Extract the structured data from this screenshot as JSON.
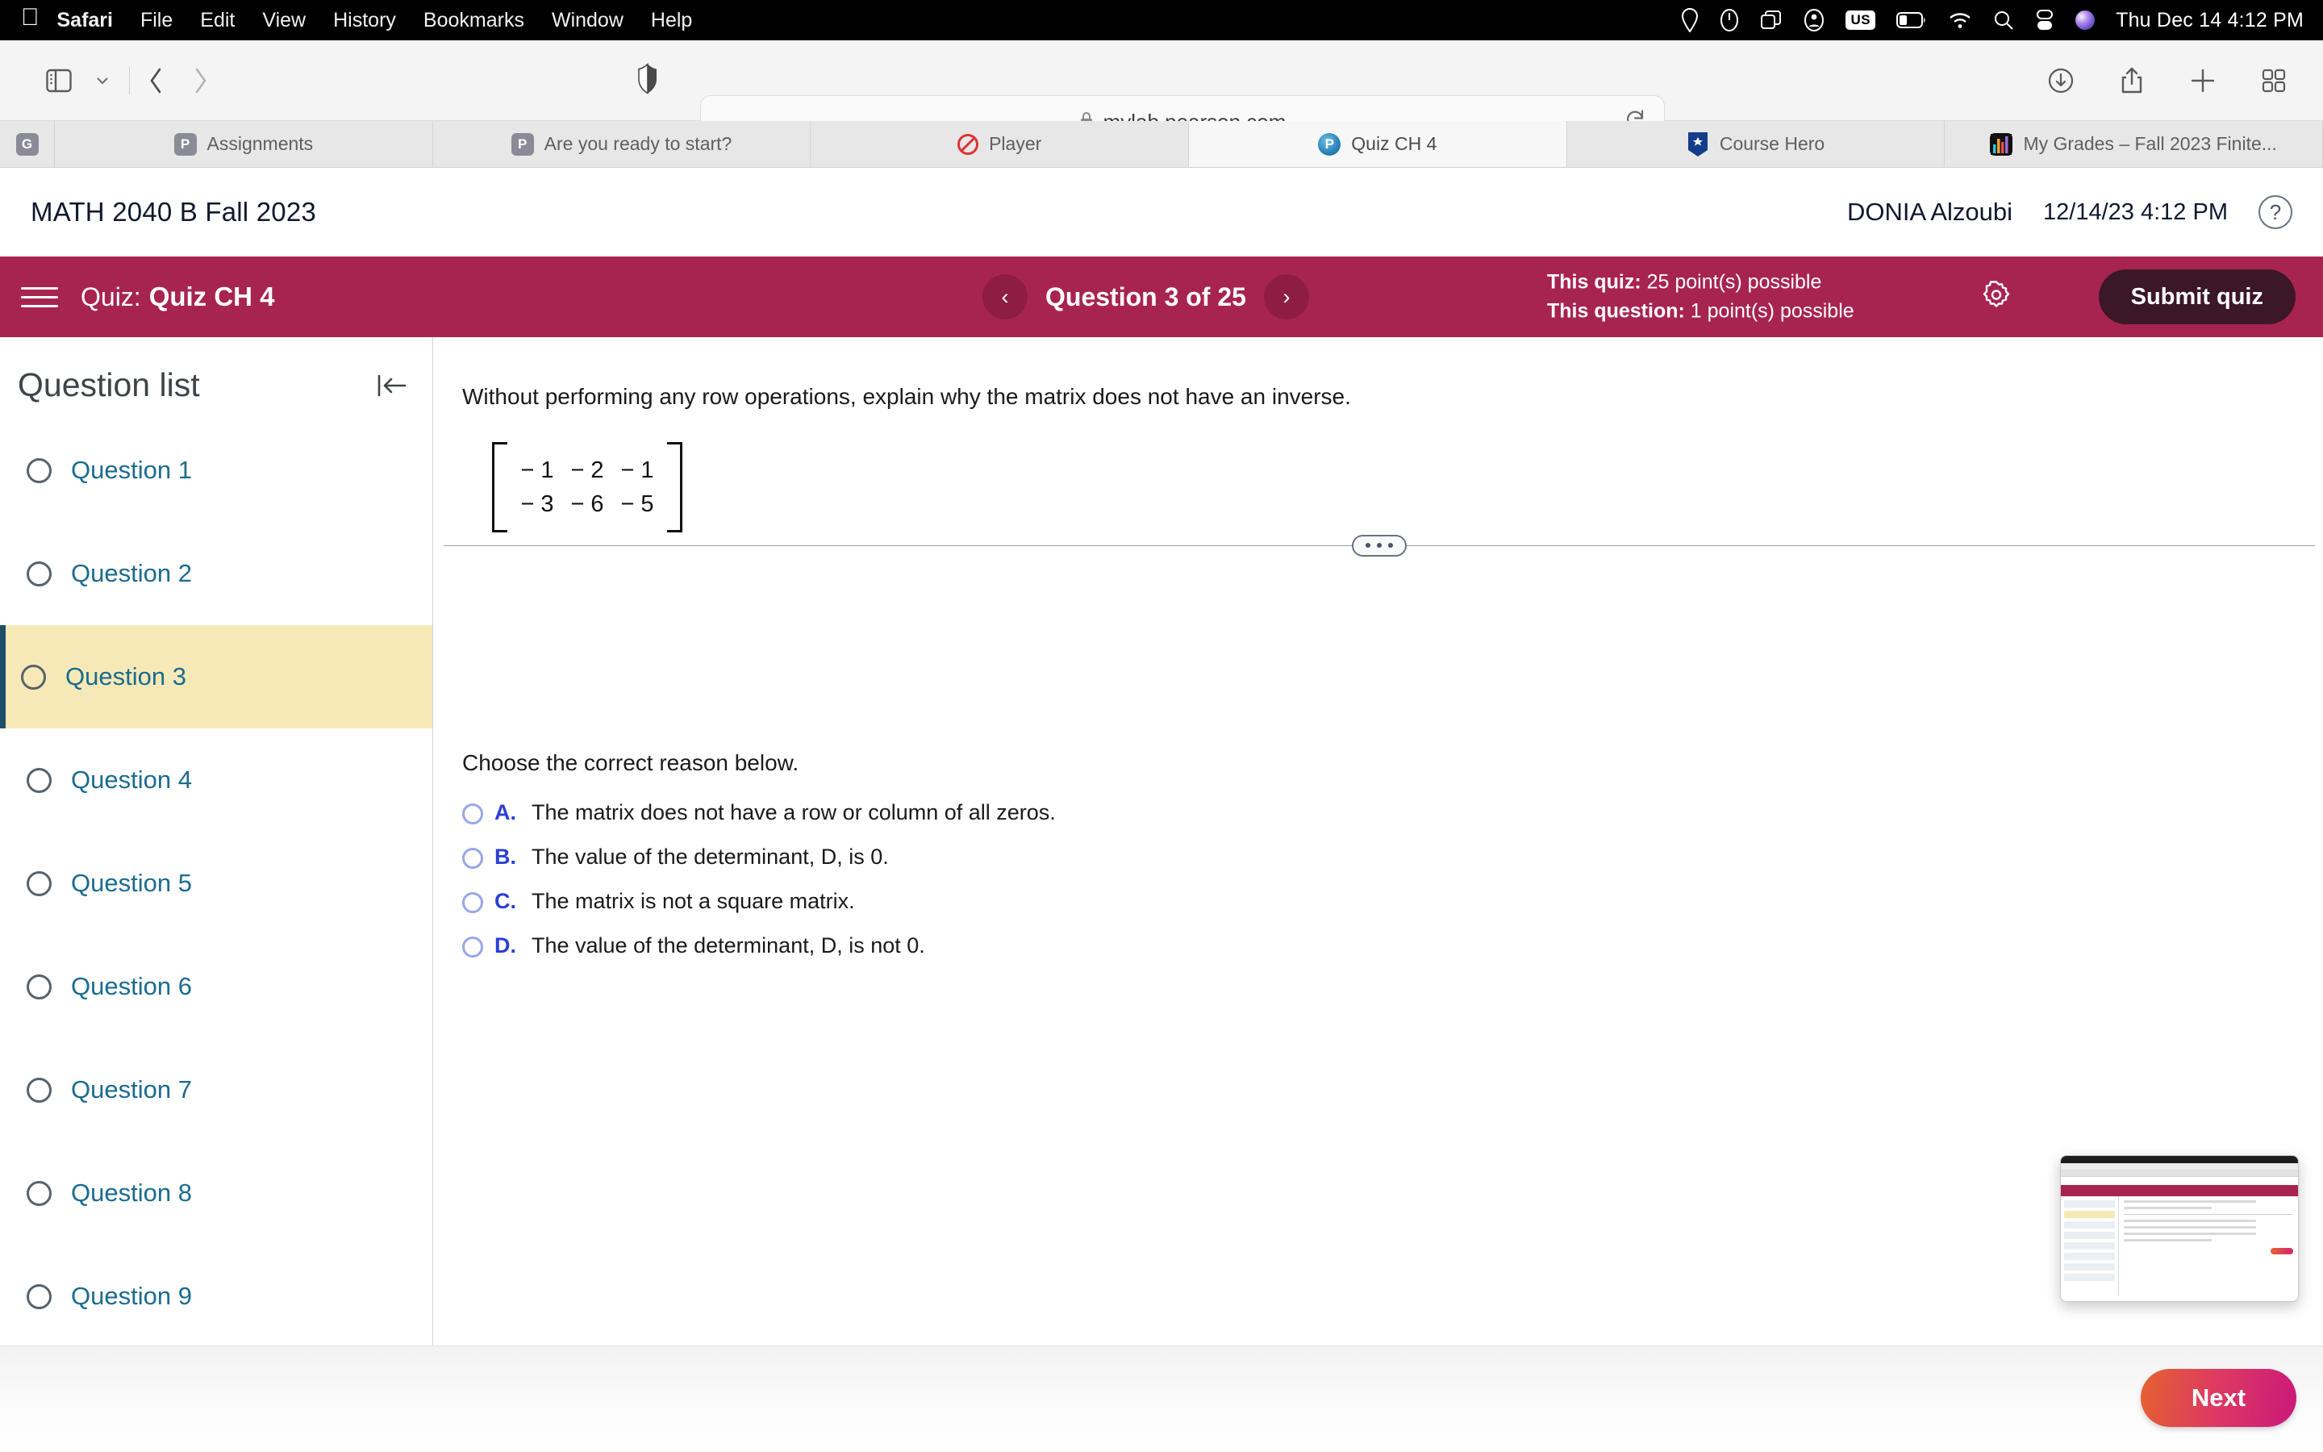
{
  "os_menubar": {
    "apple_icon": "apple-icon",
    "items": [
      {
        "label": "Safari",
        "bold": true
      },
      {
        "label": "File",
        "bold": false
      },
      {
        "label": "Edit",
        "bold": false
      },
      {
        "label": "View",
        "bold": false
      },
      {
        "label": "History",
        "bold": false
      },
      {
        "label": "Bookmarks",
        "bold": false
      },
      {
        "label": "Window",
        "bold": false
      },
      {
        "label": "Help",
        "bold": false
      }
    ],
    "status_icons": [
      "location-icon",
      "clock-icon",
      "screen-mirroring-icon",
      "user-account-icon",
      "keyboard-input-icon",
      "battery-icon",
      "wifi-icon",
      "search-icon",
      "control-center-icon",
      "siri-icon"
    ],
    "input_source": "US",
    "clock": "Thu Dec 14  4:12 PM"
  },
  "browser": {
    "toolbar_icons": [
      "sidebar-icon",
      "chevron-down-icon",
      "back-icon",
      "forward-icon",
      "shield-icon",
      "downloads-icon",
      "share-icon",
      "new-tab-icon",
      "tab-overview-icon"
    ],
    "url": "mylab.pearson.com",
    "lock_icon": "lock-icon",
    "reload_icon": "reload-icon",
    "tabs": [
      {
        "label": "",
        "favicon": "grammarly-icon",
        "favicon_text": "G",
        "kind": "pinned",
        "active": false
      },
      {
        "label": "Assignments",
        "favicon": "pearson-icon",
        "favicon_text": "P",
        "kind": "flex",
        "active": false
      },
      {
        "label": "Are you ready to start?",
        "favicon": "pearson-icon",
        "favicon_text": "P",
        "kind": "flex",
        "active": false
      },
      {
        "label": "Player",
        "favicon": "no-entry-icon",
        "favicon_text": "",
        "kind": "flex",
        "active": false
      },
      {
        "label": "Quiz CH 4",
        "favicon": "pearson-globe-icon",
        "favicon_text": "P",
        "kind": "flex",
        "active": true
      },
      {
        "label": "Course Hero",
        "favicon": "course-hero-icon",
        "favicon_text": "",
        "kind": "flex",
        "active": false
      },
      {
        "label": "My Grades – Fall 2023 Finite...",
        "favicon": "bar-chart-icon",
        "favicon_text": "",
        "kind": "flex",
        "active": false
      }
    ]
  },
  "course_header": {
    "title": "MATH 2040 B Fall 2023",
    "user": "DONIA Alzoubi",
    "timestamp": "12/14/23 4:12 PM",
    "help_icon": "question-mark-icon"
  },
  "quiz_bar": {
    "menu_icon": "hamburger-menu-icon",
    "quiz_prefix": "Quiz:",
    "quiz_name": "Quiz CH 4",
    "prev_icon": "chevron-left-icon",
    "next_icon": "chevron-right-icon",
    "counter": "Question 3 of 25",
    "quiz_points_label": "This quiz:",
    "quiz_points_value": "25 point(s) possible",
    "question_points_label": "This question:",
    "question_points_value": "1 point(s) possible",
    "settings_icon": "gear-icon",
    "submit_label": "Submit quiz",
    "background_color": "#a82450",
    "submit_color": "#3b1727"
  },
  "sidebar": {
    "title": "Question list",
    "collapse_icon": "collapse-left-icon",
    "items": [
      {
        "label": "Question 1",
        "active": false
      },
      {
        "label": "Question 2",
        "active": false
      },
      {
        "label": "Question 3",
        "active": true
      },
      {
        "label": "Question 4",
        "active": false
      },
      {
        "label": "Question 5",
        "active": false
      },
      {
        "label": "Question 6",
        "active": false
      },
      {
        "label": "Question 7",
        "active": false
      },
      {
        "label": "Question 8",
        "active": false
      },
      {
        "label": "Question 9",
        "active": false
      }
    ],
    "active_highlight_color": "#f7e9b7",
    "active_border_color": "#1d5068",
    "link_color": "#1b6b8f"
  },
  "question": {
    "stem": "Without performing any row operations, explain why the matrix does not have an inverse.",
    "matrix": [
      [
        "− 1",
        "− 2",
        "− 1"
      ],
      [
        "− 3",
        "− 6",
        "− 5"
      ]
    ],
    "divider_handle_icon": "drag-handle-dots-icon",
    "prompt": "Choose the correct reason below.",
    "options": [
      {
        "letter": "A.",
        "text": "The matrix does not have a row or column of all zeros.",
        "selected": false
      },
      {
        "letter": "B.",
        "text": "The value of the determinant, D, is 0.",
        "selected": false
      },
      {
        "letter": "C.",
        "text": "The matrix is not a square matrix.",
        "selected": false
      },
      {
        "letter": "D.",
        "text": "The value of the determinant, D, is not 0.",
        "selected": false
      }
    ],
    "option_letter_color": "#2b3fd4"
  },
  "pip": {
    "name": "picture-in-picture-preview"
  },
  "footer": {
    "next_label": "Next",
    "next_gradient_from": "#e4622f",
    "next_gradient_to": "#c9187a"
  }
}
